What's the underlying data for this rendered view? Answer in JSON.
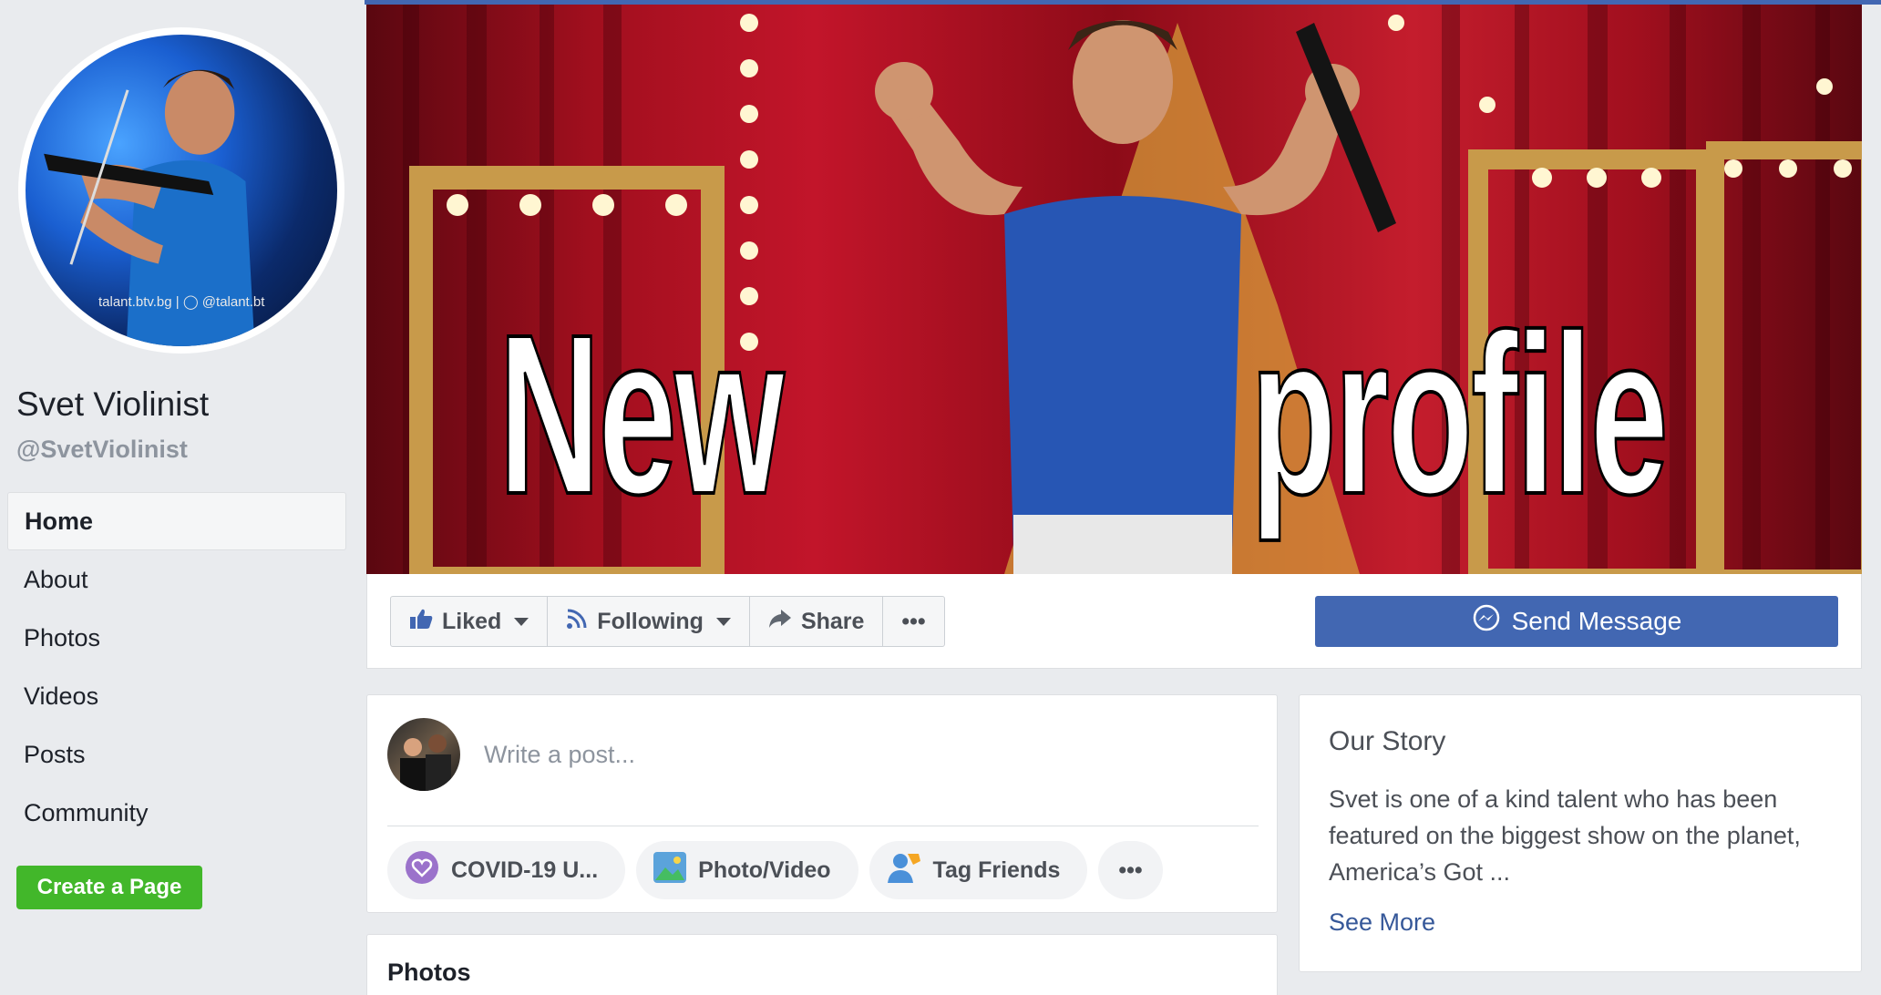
{
  "page": {
    "name": "Svet Violinist",
    "handle": "@SvetViolinist",
    "avatar_caption": "talant.btv.bg  |  ◯ @talant.bt"
  },
  "sidebar": {
    "items": [
      {
        "label": "Home",
        "active": true
      },
      {
        "label": "About"
      },
      {
        "label": "Photos"
      },
      {
        "label": "Videos"
      },
      {
        "label": "Posts"
      },
      {
        "label": "Community"
      }
    ],
    "create_page": "Create a Page"
  },
  "cover": {
    "word1": "New",
    "word2": "profile"
  },
  "actions": {
    "liked": "Liked",
    "following": "Following",
    "share": "Share",
    "more": "•••",
    "send_message": "Send Message"
  },
  "composer": {
    "placeholder": "Write a post...",
    "pills": [
      "COVID-19 U...",
      "Photo/Video",
      "Tag Friends",
      "•••"
    ]
  },
  "photos": {
    "title": "Photos"
  },
  "story": {
    "heading": "Our Story",
    "text": "Svet is one of a kind talent who has been featured on the biggest show on the planet, America’s Got ...",
    "see_more": "See More"
  },
  "colors": {
    "brand": "#4267b2",
    "green": "#42b72a",
    "link": "#365899",
    "background": "#e9ebee"
  }
}
